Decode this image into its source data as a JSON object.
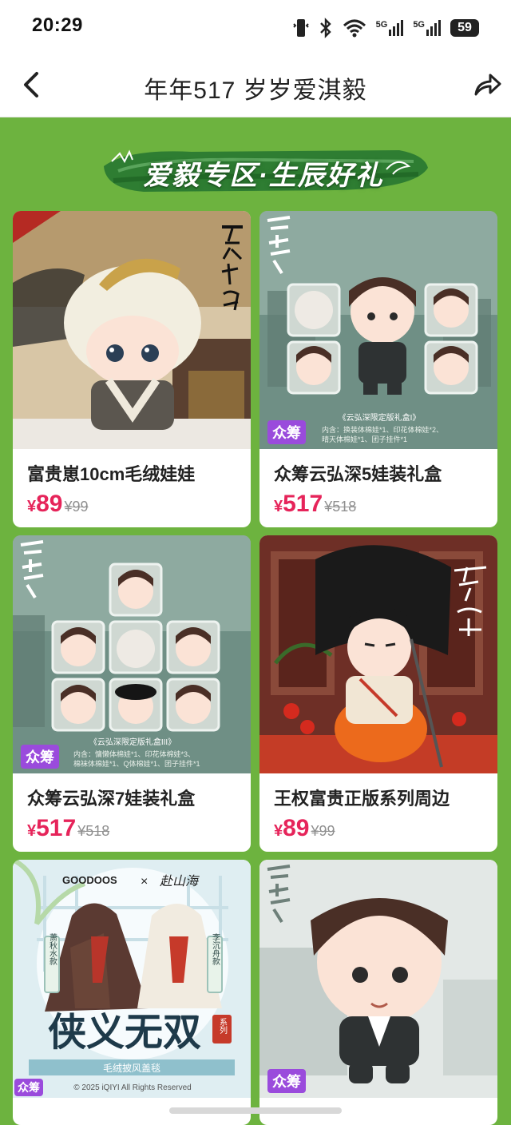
{
  "status": {
    "time": "20:29",
    "net1": "5G",
    "net2": "5G",
    "battery": "59"
  },
  "nav": {
    "title": "年年517 岁岁爱淇毅"
  },
  "banner": {
    "text": "爱毅专区·生辰好礼"
  },
  "cards": [
    {
      "name": "富贵崽10cm毛绒娃娃",
      "currency": "¥",
      "price": "89",
      "old": "¥99",
      "overlay": "天地剑心"
    },
    {
      "name": "众筹云弘深5娃装礼盒",
      "currency": "¥",
      "price": "517",
      "old": "¥518",
      "badge": "众筹",
      "overlay": "深潜",
      "caption": "《云弘深限定版礼盒I》",
      "sub1": "内含：换装体棉娃*1、印花体棉娃*2、",
      "sub2": "晴天体棉娃*1、团子挂件*1"
    },
    {
      "name": "众筹云弘深7娃装礼盒",
      "currency": "¥",
      "price": "517",
      "old": "¥518",
      "badge": "众筹",
      "overlay": "深潜",
      "caption": "《云弘深限定版礼盒III》",
      "sub1": "内含：慵懒体棉娃*1、印花体棉娃*3、",
      "sub2": "棉袜体棉娃*1、Q体棉娃*1、团子挂件*1"
    },
    {
      "name": "王权富贵正版系列周边",
      "currency": "¥",
      "price": "89",
      "old": "¥99",
      "overlay": "天地剑心"
    },
    {
      "badge": "众筹",
      "brand": "GOODOOS",
      "collab": "赴山海",
      "left_tag": "萧秋水款",
      "right_tag": "李沉舟款",
      "big": "侠义无双",
      "small": "系列",
      "strip": "毛绒披风盖毯",
      "copyright": "© 2025 iQIYI All Rights Reserved"
    },
    {
      "badge": "众筹",
      "overlay": "深潜"
    }
  ]
}
